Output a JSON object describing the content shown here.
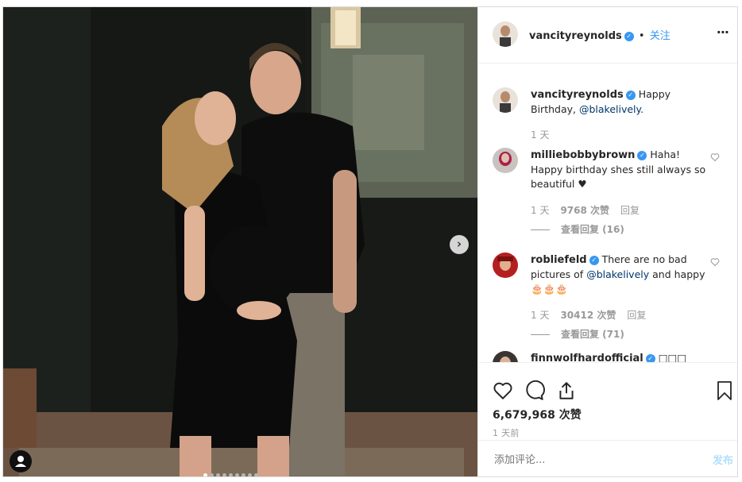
{
  "post": {
    "author": "vancityreynolds",
    "follow_label": "关注",
    "separator": "•",
    "more_label": "···",
    "photo_dots": 9,
    "photo_active_dot": 0
  },
  "caption": {
    "author": "vancityreynolds",
    "text": "Happy Birthday,",
    "mention": "@blakelively.",
    "time": "1 天"
  },
  "comments": [
    {
      "author": "milliebobbybrown",
      "text": "Haha! Happy birthday shes still always so beautiful ♥",
      "time": "1 天",
      "likes": "9768 次赞",
      "reply": "回复",
      "view_replies": "查看回复 (16)"
    },
    {
      "author": "robliefeld",
      "text_before": "There are no bad pictures of",
      "mention": "@blakelively",
      "text_after": "and happy 🎂🎂🎂",
      "time": "1 天",
      "likes": "30412 次赞",
      "reply": "回复",
      "view_replies": "查看回复 (71)"
    },
    {
      "author": "finnwolfhardofficial",
      "text": "□□□"
    }
  ],
  "stats": {
    "likes": "6,679,968 次赞",
    "time": "1 天前"
  },
  "add_comment": {
    "placeholder": "添加评论...",
    "post_label": "发布"
  },
  "colors": {
    "accent": "#3897f0",
    "post_disabled": "#b2dffc",
    "photo_bg": "#121411"
  }
}
